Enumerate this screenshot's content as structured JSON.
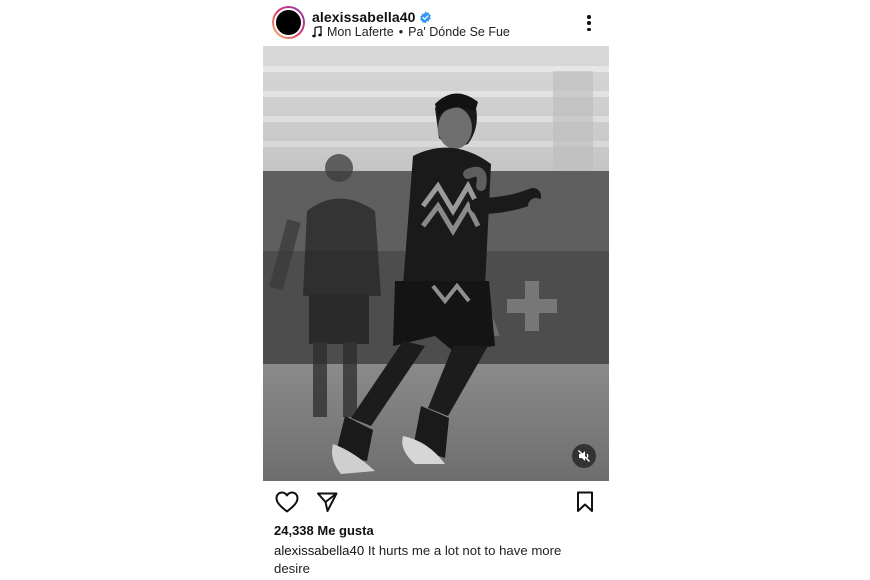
{
  "post": {
    "username": "alexissabella40",
    "verified": true,
    "music_artist": "Mon Laferte",
    "music_separator": "•",
    "music_song": "Pa' Dónde Se Fue",
    "likes_text": "24,338 Me gusta",
    "caption_user": "alexissabella40",
    "caption_text": "It hurts me a lot not to have more desire"
  },
  "icons": {
    "verified": "verified-badge-icon",
    "music": "music-note-icon",
    "more": "more-options-icon",
    "like": "heart-icon",
    "share": "send-icon",
    "save": "bookmark-icon",
    "mute": "speaker-muted-icon"
  },
  "colors": {
    "verified_blue": "#3897f0",
    "text": "#111111",
    "photo_tone": "grayscale"
  }
}
